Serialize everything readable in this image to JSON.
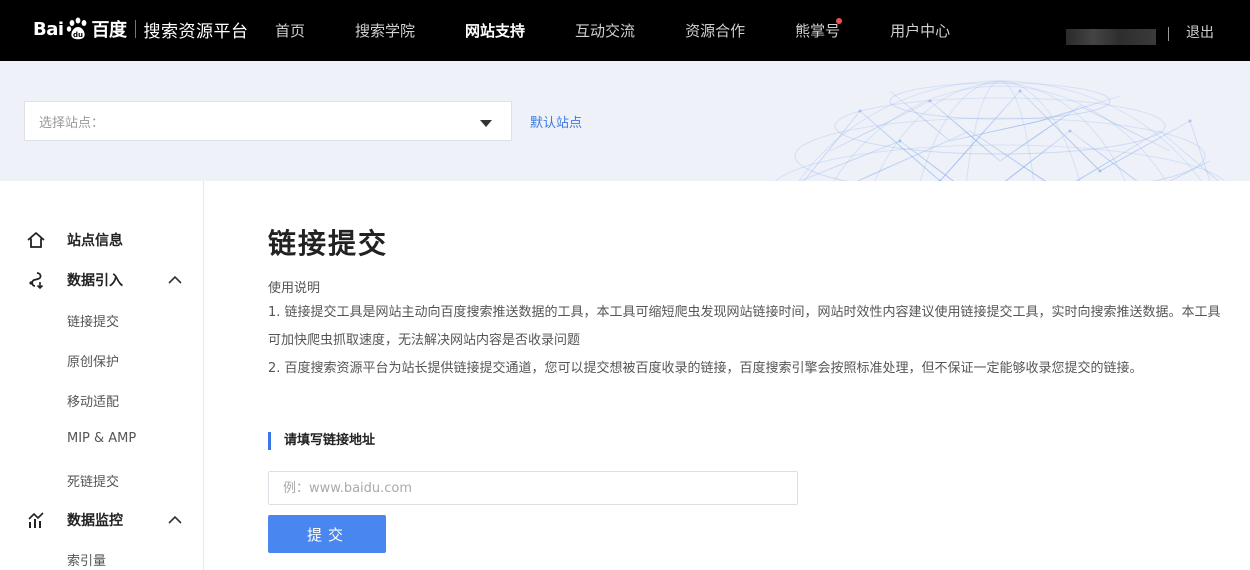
{
  "header": {
    "logo_bai": "Bai",
    "logo_du": "百度",
    "logo_paw_icon": "baidu-paw-logo",
    "platform_name": "搜索资源平台",
    "nav": [
      {
        "label": "首页",
        "active": false,
        "has_dot": false
      },
      {
        "label": "搜索学院",
        "active": false,
        "has_dot": false
      },
      {
        "label": "网站支持",
        "active": true,
        "has_dot": false
      },
      {
        "label": "互动交流",
        "active": false,
        "has_dot": false
      },
      {
        "label": "资源合作",
        "active": false,
        "has_dot": false
      },
      {
        "label": "熊掌号",
        "active": false,
        "has_dot": true
      },
      {
        "label": "用户中心",
        "active": false,
        "has_dot": false
      }
    ],
    "logout_label": "退出",
    "notification_dot_color": "#f0504e"
  },
  "banner": {
    "site_select_label": "选择站点：",
    "default_site_link": "默认站点",
    "globe_decoration": "wireframe-globe"
  },
  "sidebar": {
    "groups": [
      {
        "label": "站点信息",
        "icon": "home-icon",
        "expandable": false,
        "sub_items": []
      },
      {
        "label": "数据引入",
        "icon": "data-import-icon",
        "expandable": true,
        "expanded": true,
        "sub_items": [
          "链接提交",
          "原创保护",
          "移动适配",
          "MIP & AMP",
          "死链提交"
        ]
      },
      {
        "label": "数据监控",
        "icon": "chart-icon",
        "expandable": true,
        "expanded": true,
        "sub_items": [
          "索引量"
        ]
      }
    ]
  },
  "main": {
    "title": "链接提交",
    "usage_title": "使用说明",
    "description_1": "1. 链接提交工具是网站主动向百度搜索推送数据的工具，本工具可缩短爬虫发现网站链接时间，网站时效性内容建议使用链接提交工具，实时向搜索推送数据。本工具可加快爬虫抓取速度，无法解决网站内容是否收录问题",
    "description_2": "2. 百度搜索资源平台为站长提供链接提交通道，您可以提交想被百度收录的链接，百度搜索引擎会按照标准处理，但不保证一定能够收录您提交的链接。",
    "section_title": "请填写链接地址",
    "url_input": {
      "value": "",
      "placeholder": "例：www.baidu.com"
    },
    "submit_label": "提交"
  },
  "colors": {
    "topbar_bg": "#000000",
    "banner_bg": "#eef1f8",
    "accent": "#3b78e7",
    "button_bg": "#4a86f0"
  }
}
